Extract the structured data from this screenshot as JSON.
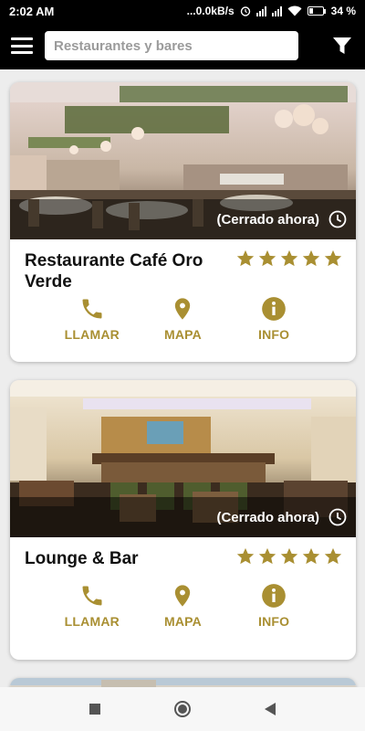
{
  "status_bar": {
    "time": "2:02 AM",
    "speed": "...0.0kB/s",
    "battery": "34 %",
    "battery_level": 0.34
  },
  "search": {
    "placeholder": "Restaurantes y bares"
  },
  "colors": {
    "accent": "#a98f32",
    "app_bar": "#000000"
  },
  "cards": [
    {
      "title": "Restaurante Café Oro Verde",
      "status": "(Cerrado ahora)",
      "rating": 5,
      "actions": {
        "call": "LLAMAR",
        "map": "MAPA",
        "info": "INFO"
      }
    },
    {
      "title": "Lounge & Bar",
      "status": "(Cerrado ahora)",
      "rating": 5,
      "actions": {
        "call": "LLAMAR",
        "map": "MAPA",
        "info": "INFO"
      }
    }
  ],
  "icons": {
    "menu": "menu-icon",
    "filter": "filter-icon",
    "clock": "clock-icon",
    "star": "star-icon",
    "phone": "phone-icon",
    "map_pin": "map-pin-icon",
    "info": "info-icon",
    "nav_recents": "square-icon",
    "nav_home": "circle-icon",
    "nav_back": "triangle-back-icon"
  }
}
